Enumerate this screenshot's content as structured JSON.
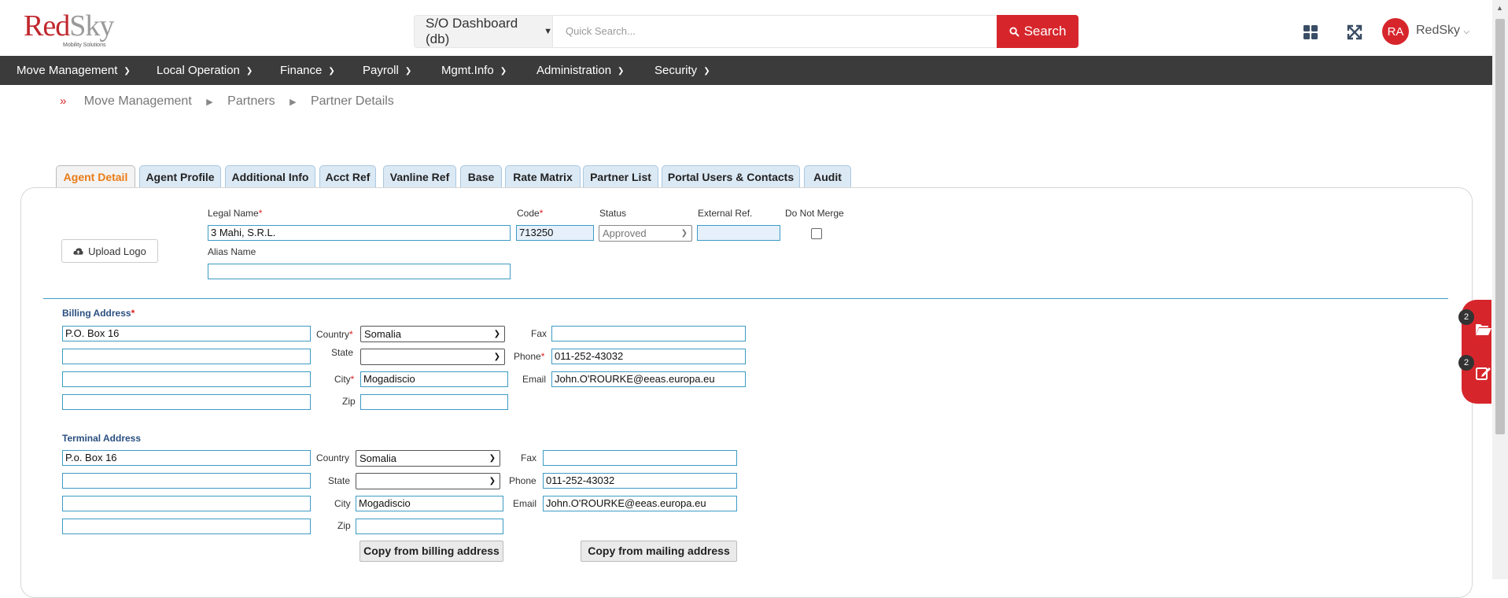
{
  "brand": {
    "name_red": "Red",
    "name_grey": "Sky",
    "tagline": "Mobility Solutions"
  },
  "header": {
    "dashboard_select": "S/O Dashboard (db)",
    "search_placeholder": "Quick Search...",
    "search_button": "Search",
    "avatar_initials": "RA",
    "user_name": "RedSky",
    "accent_color": "#d6262c"
  },
  "nav": {
    "items": [
      "Move Management",
      "Local Operation",
      "Finance",
      "Payroll",
      "Mgmt.Info",
      "Administration",
      "Security"
    ]
  },
  "breadcrumb": [
    "Move Management",
    "Partners",
    "Partner Details"
  ],
  "tabs": [
    "Agent Detail",
    "Agent Profile",
    "Additional Info",
    "Acct Ref",
    "Vanline Ref",
    "Base",
    "Rate Matrix",
    "Partner List",
    "Portal Users & Contacts",
    "Audit"
  ],
  "active_tab": "Agent Detail",
  "agent": {
    "upload_logo": "Upload Logo",
    "legal_name_label": "Legal Name",
    "legal_name": "3 Mahi, S.R.L.",
    "code_label": "Code",
    "code": "713250",
    "status_label": "Status",
    "status": "Approved",
    "external_ref_label": "External Ref.",
    "external_ref": "",
    "do_not_merge_label": "Do Not Merge",
    "do_not_merge": false,
    "alias_label": "Alias Name",
    "alias": ""
  },
  "billing": {
    "title": "Billing Address",
    "line1": "P.O. Box 16",
    "line2": "",
    "line3": "",
    "line4": "",
    "country_label": "Country",
    "country": "Somalia",
    "state_label": "State",
    "state": "",
    "city_label": "City",
    "city": "Mogadiscio",
    "zip_label": "Zip",
    "zip": "",
    "fax_label": "Fax",
    "fax": "",
    "phone_label": "Phone",
    "phone": "011-252-43032",
    "email_label": "Email",
    "email": "John.O'ROURKE@eeas.europa.eu"
  },
  "terminal": {
    "title": "Terminal Address",
    "line1": "P.o. Box 16",
    "line2": "",
    "line3": "",
    "line4": "",
    "country_label": "Country",
    "country": "Somalia",
    "state_label": "State",
    "state": "",
    "city_label": "City",
    "city": "Mogadiscio",
    "zip_label": "Zip",
    "zip": "",
    "fax_label": "Fax",
    "fax": "",
    "phone_label": "Phone",
    "phone": "011-252-43032",
    "email_label": "Email",
    "email": "John.O'ROURKE@eeas.europa.eu",
    "copy_billing": "Copy from billing address",
    "copy_mailing": "Copy from mailing address"
  },
  "float_panel": {
    "files_count": "2",
    "notes_count": "2"
  }
}
